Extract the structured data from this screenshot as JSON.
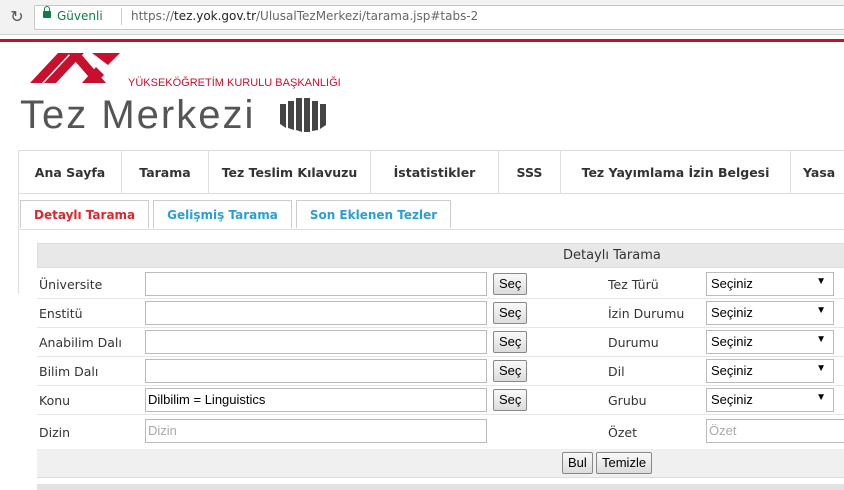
{
  "browser": {
    "secure_label": "Güvenli",
    "url_scheme": "https://",
    "url_host": "tez.yok.gov.tr",
    "url_path": "/UlusalTezMerkezi/tarama.jsp#tabs-2"
  },
  "header": {
    "org_name": "YÜKSEKÖĞRETİM KURULU BAŞKANLIĞI",
    "site_title": "Tez Merkezi",
    "brand_color": "#c8102e"
  },
  "menu": [
    "Ana Sayfa",
    "Tarama",
    "Tez Teslim Kılavuzu",
    "İstatistikler",
    "SSS",
    "Tez Yayımlama İzin Belgesi",
    "Yasa"
  ],
  "tabs": [
    {
      "label": "Detaylı Tarama",
      "active": true
    },
    {
      "label": "Gelişmiş Tarama",
      "active": false
    },
    {
      "label": "Son Eklenen Tezler",
      "active": false
    }
  ],
  "form": {
    "title": "Detaylı Tarama",
    "select_button": "Seç",
    "left_fields": [
      {
        "label": "Üniversite",
        "value": "",
        "placeholder": ""
      },
      {
        "label": "Enstitü",
        "value": "",
        "placeholder": ""
      },
      {
        "label": "Anabilim Dalı",
        "value": "",
        "placeholder": ""
      },
      {
        "label": "Bilim Dalı",
        "value": "",
        "placeholder": ""
      },
      {
        "label": "Konu",
        "value": "Dilbilim = Linguistics",
        "placeholder": ""
      },
      {
        "label": "Dizin",
        "value": "",
        "placeholder": "Dizin"
      }
    ],
    "right_fields": [
      {
        "label": "Tez Türü",
        "value": "Seçiniz"
      },
      {
        "label": "İzin Durumu",
        "value": "Seçiniz"
      },
      {
        "label": "Durumu",
        "value": "Seçiniz"
      },
      {
        "label": "Dil",
        "value": "Seçiniz"
      },
      {
        "label": "Grubu",
        "value": "Seçiniz"
      },
      {
        "label": "Özet",
        "value": "",
        "placeholder": "Özet"
      }
    ],
    "search_button": "Bul",
    "clear_button": "Temizle"
  }
}
